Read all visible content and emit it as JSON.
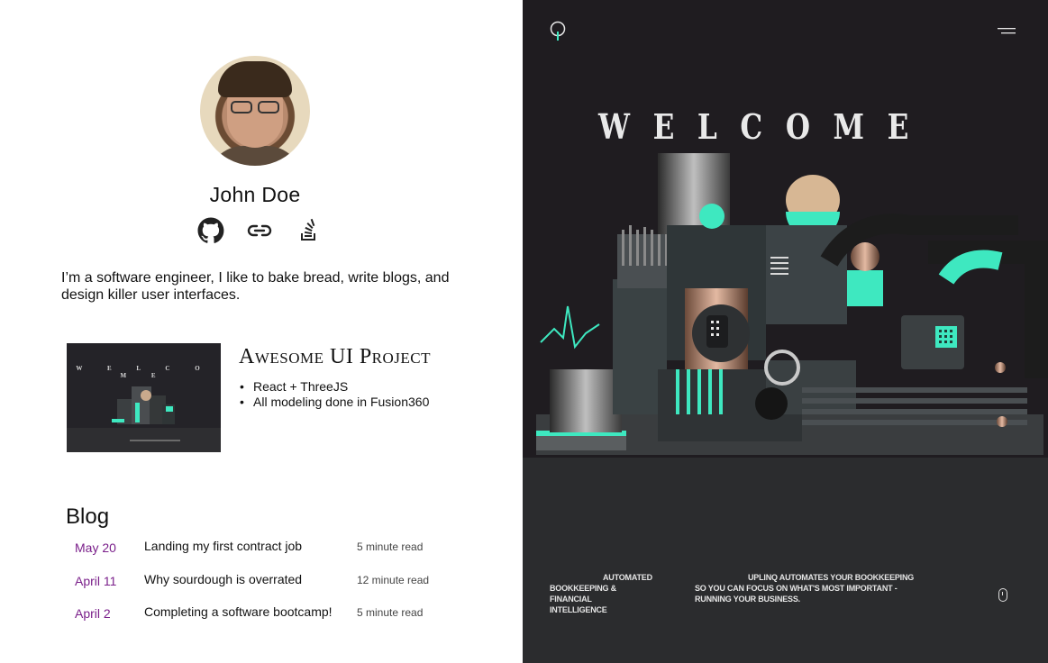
{
  "profile": {
    "name": "John Doe",
    "bio": "I’m a software engineer, I like to bake bread, write blogs, and design killer user interfaces.",
    "social_icons": [
      "github-icon",
      "link-icon",
      "stackoverflow-icon"
    ]
  },
  "project": {
    "title": "Awesome UI Project",
    "bullets": [
      "React + ThreeJS",
      "All modeling done in Fusion360"
    ],
    "thumbnail_welcome": "W E L C O M E"
  },
  "blog": {
    "heading": "Blog",
    "posts": [
      {
        "date": "May 20",
        "title": "Landing my first contract job",
        "read": "5 minute read"
      },
      {
        "date": "April 11",
        "title": "Why sourdough is overrated",
        "read": "12 minute read"
      },
      {
        "date": "April 2",
        "title": "Completing a software bootcamp!",
        "read": "5 minute read"
      }
    ]
  },
  "showcase": {
    "welcome_letters": [
      "W",
      "E",
      "L",
      "C",
      "O",
      "M",
      "E"
    ],
    "caption_left_1": "AUTOMATED",
    "caption_left_2": "BOOKKEEPING &",
    "caption_left_3": "FINANCIAL",
    "caption_left_4": "INTELLIGENCE",
    "caption_right_1": "UPLINQ AUTOMATES YOUR BOOKKEEPING",
    "caption_right_2": "SO YOU CAN FOCUS ON WHAT'S MOST IMPORTANT -",
    "caption_right_3": "RUNNING YOUR BUSINESS.",
    "icons": [
      "logo-icon",
      "menu-icon",
      "mouse-scroll-icon"
    ]
  },
  "colors": {
    "date_accent": "#7a1f8a",
    "dark_bg": "#1f1c20",
    "teal": "#3ee8c0"
  }
}
